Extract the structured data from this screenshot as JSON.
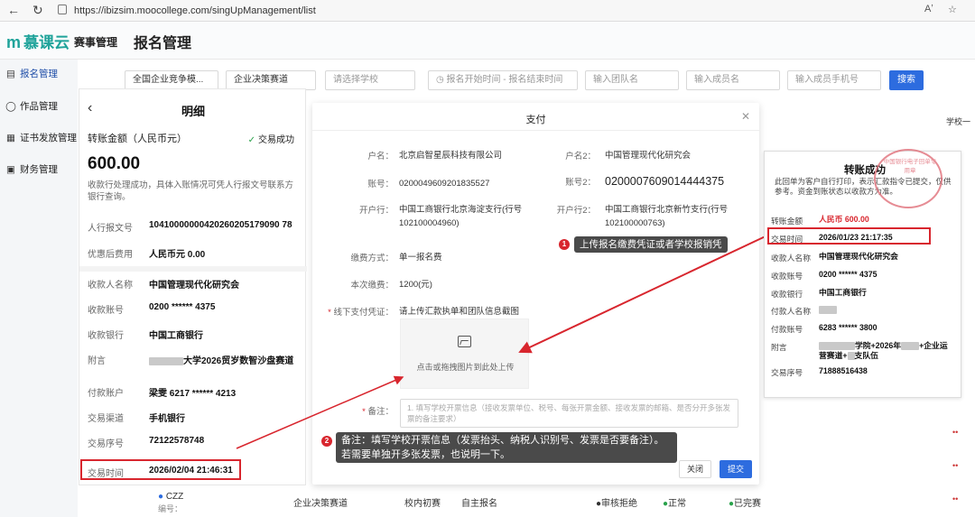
{
  "browser": {
    "url": "https://ibizsim.moocollege.com/singUpManagement/list",
    "read_aloud": "Aʼ"
  },
  "app": {
    "logo_text": "慕课云",
    "nav_label": "赛事管理",
    "page_title": "报名管理"
  },
  "sidebar": {
    "items": [
      {
        "label": "报名管理",
        "icon": "registration-icon"
      },
      {
        "label": "作品管理",
        "icon": "bulb-icon"
      },
      {
        "label": "证书发放管理",
        "icon": "certificate-icon"
      },
      {
        "label": "财务管理",
        "icon": "finance-icon"
      }
    ]
  },
  "filters": {
    "competition": "全国企业竞争模...",
    "track": "企业决策赛道",
    "school_placeholder": "请选择学校",
    "start_time_placeholder": "报名开始时间",
    "end_time_placeholder": "报名结束时间",
    "team_placeholder": "输入团队名",
    "member_placeholder": "输入成员名",
    "phone_placeholder": "输入成员手机号",
    "search_button": "搜索",
    "right_header": "学校一"
  },
  "bottom_row": {
    "name": "CZZ",
    "code_label": "编号：",
    "track": "企业决策赛道",
    "round": "校内初赛",
    "mode": "自主报名",
    "status1": "审核拒绝",
    "status2": "正常",
    "status3": "已完赛"
  },
  "detail": {
    "title": "明细",
    "amount_label": "转账金额（人民币元）",
    "status": "交易成功",
    "amount": "600.00",
    "hint": "收款行处理成功，具体入账情况可凭人行报文号联系方银行查询。",
    "pboc_label": "人行报文号",
    "pboc_value": "10410000000420260205179090 78",
    "fee_label": "优惠后费用",
    "fee_value": "人民币元 0.00",
    "payee_label": "收款人名称",
    "payee_value": "中国管理现代化研究会",
    "payee_acct_label": "收款账号",
    "payee_acct_value": "0200 ****** 4375",
    "payee_bank_label": "收款银行",
    "payee_bank_value": "中国工商银行",
    "memo_label": "附言",
    "memo_value": "大学2026贸岁数智沙盘赛道",
    "payer_label": "付款账户",
    "payer_value": "梁雯 6217 ****** 4213",
    "channel_label": "交易渠道",
    "channel_value": "手机银行",
    "serial_label": "交易序号",
    "serial_value": "72122578748",
    "time_label": "交易时间",
    "time_value": "2026/02/04 21:46:31"
  },
  "modal": {
    "title": "支付",
    "account_name_label": "户名：",
    "account_name_value": "北京启智星辰科技有限公司",
    "account_no_label": "账号：",
    "account_no_value": "0200049609201835527",
    "bank_label": "开户行：",
    "bank_value": "中国工商银行北京海淀支行(行号102100004960)",
    "account_name2_label": "户名2：",
    "account_name2_value": "中国管理现代化研究会",
    "account_no2_label": "账号2：",
    "account_no2_value": "0200007609014444375",
    "bank2_label": "开户行2：",
    "bank2_value": "中国工商银行北京新竹支行(行号102100000763)",
    "fee_method_label": "缴费方式：",
    "fee_method_value": "单一报名费",
    "fee_amount_label": "本次缴费：",
    "fee_amount_value": "1200(元)",
    "voucher_label": "线下支付凭证：",
    "voucher_hint": "请上传汇款执单和团队信息截图",
    "upload_text": "点击或拖拽图片到此处上传",
    "remark_label": "备注：",
    "remark_placeholder": "1. 填写学校开票信息（接收发票单位、税号、每张开票金额、接收发票的邮箱、是否分开多张发票的备注要求）",
    "close_button": "关闭",
    "submit_button": "提交"
  },
  "annotations": {
    "n1": "1",
    "callout1": "上传报名缴费凭证或者学校报销凭证",
    "n2": "2",
    "callout2_line1": "备注：填写学校开票信息（发票抬头、纳税人识别号、发票是否要备注）。",
    "callout2_line2": "若需要单独开多张发票，也说明一下。"
  },
  "receipt": {
    "title": "转账成功",
    "desc": "此回单为客户自行打印，表示汇款指令已提交，仅供参考。资金到账状态以收款方为准。",
    "amount_label": "转账金额",
    "amount_value": "人民币 600.00",
    "time_label": "交易时间",
    "time_value": "2026/01/23 21:17:35",
    "payee_label": "收款人名称",
    "payee_value": "中国管理现代化研究会",
    "payee_acct_label": "收款账号",
    "payee_acct_value": "0200 ****** 4375",
    "payee_bank_label": "收款银行",
    "payee_bank_value": "中国工商银行",
    "payer_label": "付款人名称",
    "payer_acct_label": "付款账号",
    "payer_acct_value": "6283 ****** 3800",
    "memo_label": "附言",
    "memo_value1": "学院+2026年",
    "memo_value2": "+企业运营赛道+",
    "memo_value3": "支队伍",
    "serial_label": "交易序号",
    "serial_value": "71888516438",
    "seal_text": "中国银行电子回单专用章"
  },
  "colors": {
    "brand": "#1fa39a",
    "primary": "#2d6cdf",
    "annotation_red": "#d8262e",
    "callout_bg": "#4a4a4a"
  }
}
